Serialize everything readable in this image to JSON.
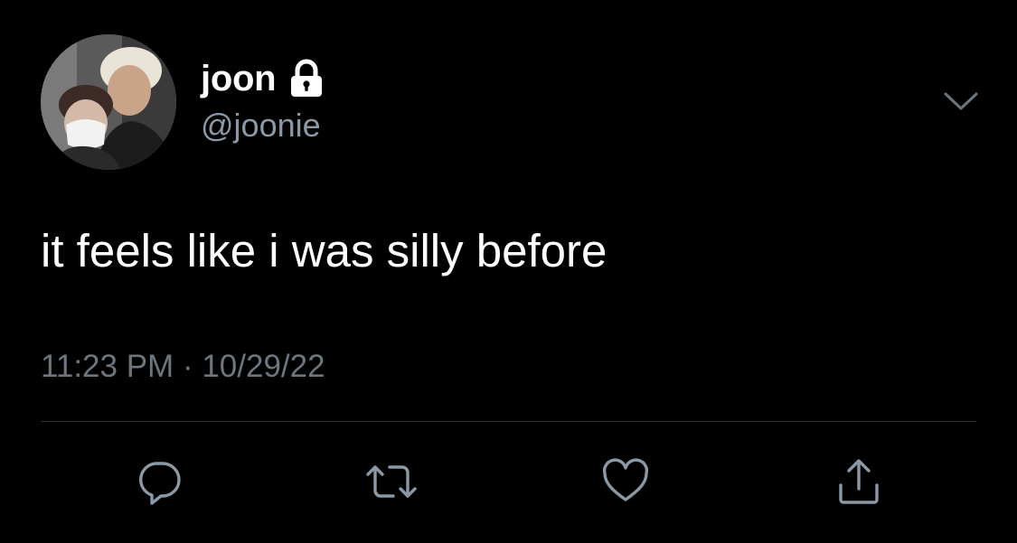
{
  "tweet": {
    "display_name": "joon",
    "handle": "@joonie",
    "protected_icon": "lock-icon",
    "text": "it feels like i was silly before",
    "time": "11:23 PM",
    "separator": "·",
    "date": "10/29/22",
    "menu_icon": "chevron-down-icon"
  },
  "actions": {
    "reply_icon": "reply-icon",
    "retweet_icon": "retweet-icon",
    "like_icon": "heart-icon",
    "share_icon": "share-icon"
  },
  "colors": {
    "background": "#000000",
    "primary_text": "#ffffff",
    "secondary_text": "#8b98a5",
    "meta_text": "#6e767d",
    "icon": "#8b98a5",
    "divider": "#2f3336"
  }
}
